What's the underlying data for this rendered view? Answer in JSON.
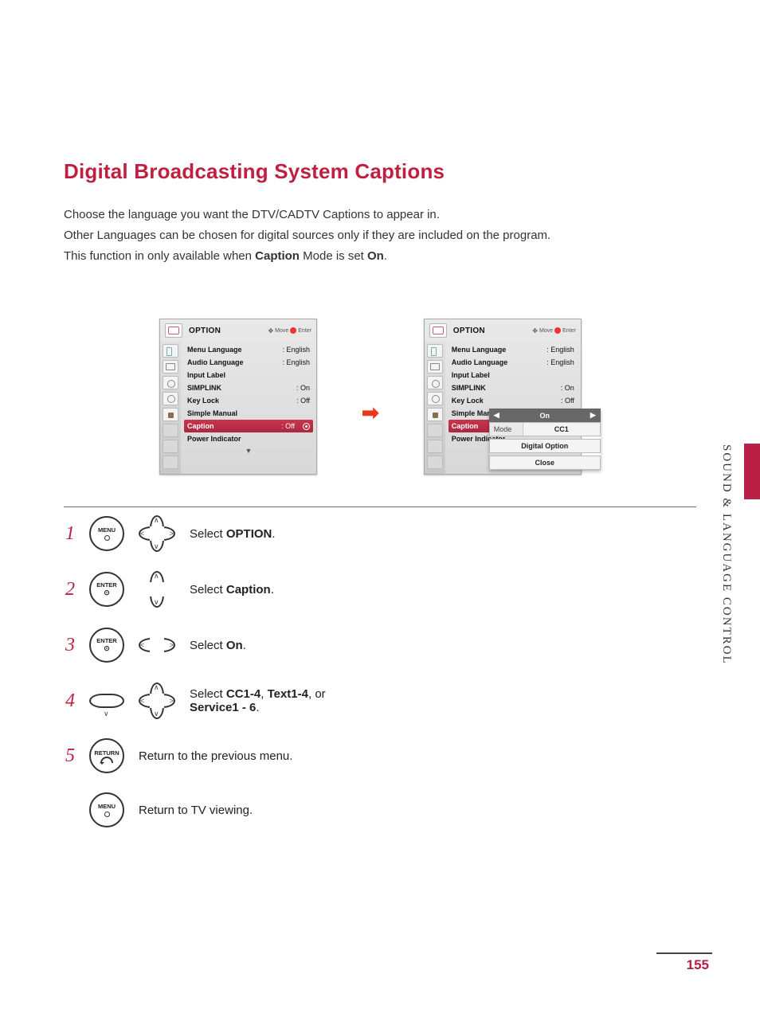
{
  "title": "Digital Broadcasting System Captions",
  "intro": {
    "l1": "Choose the language you want the DTV/CADTV Captions to appear in.",
    "l2": "Other Languages can be chosen for digital sources only if they are included on the program.",
    "l3a": "This function in only available when ",
    "l3b": "Caption",
    "l3c": " Mode is set ",
    "l3d": "On",
    "l3e": "."
  },
  "osd": {
    "header_title": "OPTION",
    "hint_move": "Move",
    "hint_enter": "Enter",
    "items": [
      {
        "label": "Menu Language",
        "value": ": English"
      },
      {
        "label": "Audio Language",
        "value": ": English"
      },
      {
        "label": "Input Label",
        "value": ""
      },
      {
        "label": "SIMPLINK",
        "value": ": On"
      },
      {
        "label": "Key Lock",
        "value": ": Off"
      },
      {
        "label": "Simple Manual",
        "value": ""
      },
      {
        "label": "Caption",
        "value": ": Off"
      },
      {
        "label": "Power Indicator",
        "value": ""
      }
    ]
  },
  "popout": {
    "top_value": "On",
    "mode_label": "Mode",
    "mode_value": "CC1",
    "digital_option": "Digital Option",
    "close": "Close"
  },
  "steps": {
    "s1_num": "1",
    "s1_btn": "MENU",
    "s1_a": "Select ",
    "s1_b": "OPTION",
    "s1_c": ".",
    "s2_num": "2",
    "s2_btn": "ENTER",
    "s2_a": "Select ",
    "s2_b": "Caption",
    "s2_c": ".",
    "s3_num": "3",
    "s3_btn": "ENTER",
    "s3_a": "Select ",
    "s3_b": "On",
    "s3_c": ".",
    "s4_num": "4",
    "s4_a": "Select ",
    "s4_b": "CC1-4",
    "s4_c": ", ",
    "s4_d": "Text1-4",
    "s4_e": ", or ",
    "s4_f": "Service1 - 6",
    "s4_g": ".",
    "s5_num": "5",
    "s5_btn": "RETURN",
    "s5_t": "Return to the previous menu.",
    "s6_btn": "MENU",
    "s6_t": "Return to TV viewing."
  },
  "side_label": "SOUND & LANGUAGE CONTROL",
  "page_number": "155"
}
